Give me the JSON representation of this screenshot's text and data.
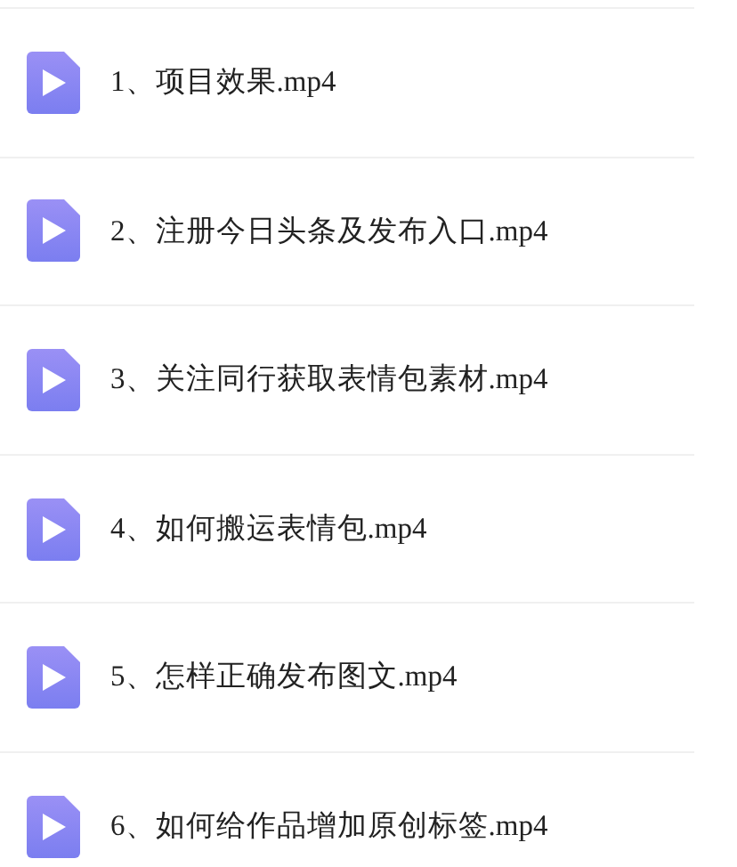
{
  "files": [
    {
      "name": "1、项目效果.mp4"
    },
    {
      "name": "2、注册今日头条及发布入口.mp4"
    },
    {
      "name": "3、关注同行获取表情包素材.mp4"
    },
    {
      "name": "4、如何搬运表情包.mp4"
    },
    {
      "name": "5、怎样正确发布图文.mp4"
    },
    {
      "name": "6、如何给作品增加原创标签.mp4"
    }
  ]
}
